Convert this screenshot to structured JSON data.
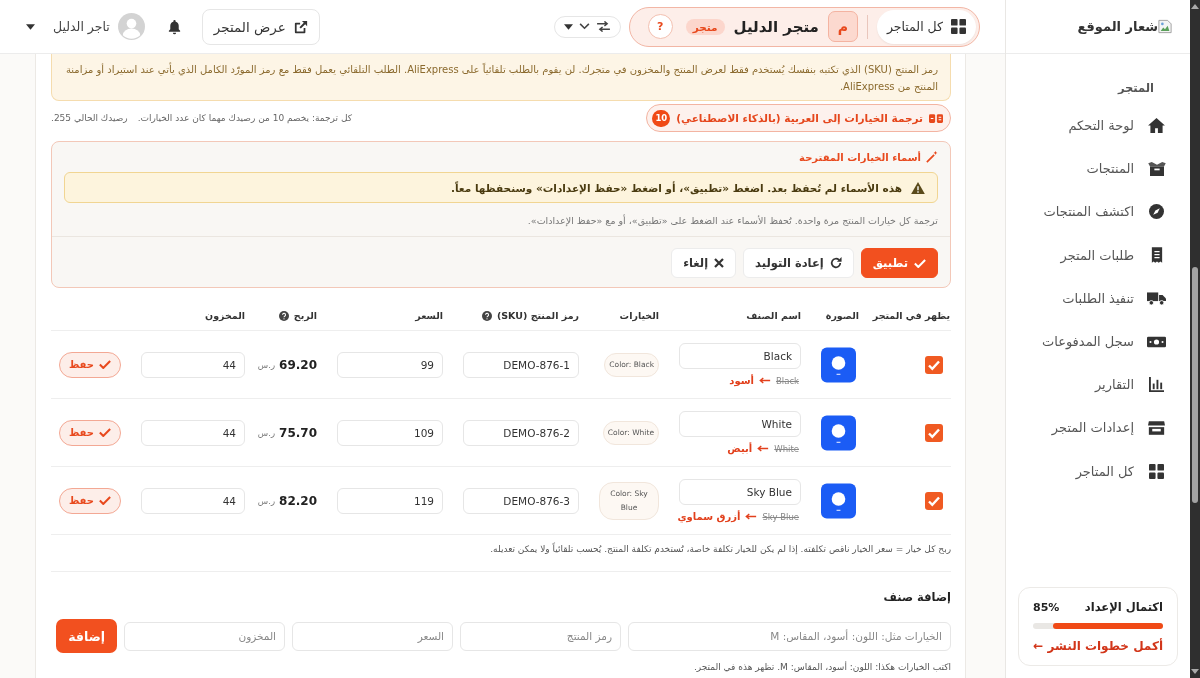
{
  "header": {
    "store_switcher": {
      "all_stores": "كل المتاجر",
      "avatar_letter": "م",
      "store_name": "متجر الدليل",
      "badge": "متجر",
      "help": "?"
    },
    "view_store": "عرض المتجر",
    "user_name": "تاجر الدليل"
  },
  "sidebar": {
    "logo": "شعار الموقع",
    "section": "المتجر",
    "items": [
      {
        "label": "لوحة التحكم",
        "selected": false
      },
      {
        "label": "المنتجات",
        "selected": false
      },
      {
        "label": "اكتشف المنتجات",
        "selected": false
      },
      {
        "label": "طلبات المتجر",
        "selected": false
      },
      {
        "label": "تنفيذ الطلبات",
        "selected": false
      },
      {
        "label": "سجل المدفوعات",
        "selected": false
      },
      {
        "label": "التقارير",
        "selected": false
      },
      {
        "label": "إعدادات المتجر",
        "selected": false
      },
      {
        "label": "كل المتاجر",
        "selected": false
      }
    ],
    "setup": {
      "title": "اكتمال الإعداد",
      "percent": "85%",
      "level": 0.85,
      "link": "أكمل خطوات النشر ←"
    }
  },
  "notice": {
    "text": "رمز المنتج (SKU) الذي تكتبه بنفسك يُستخدم فقط لعرض المنتج والمخزون في متجرك. لن يقوم بالطلب تلقائياً على AliExpress. الطلب التلقائي يعمل فقط مع رمز المورّد الكامل الذي يأتي عند استيراد أو مزامنة المنتج من AliExpress."
  },
  "translate": {
    "button": "ترجمة الخيارات إلى العربية (بالذكاء الاصطناعي)",
    "cost_badge": "10",
    "cost_note": "كل ترجمة: يخصم 10 من رصيدك مهما كان عدد الخيارات.",
    "balance": "رصيدك الحالي 255."
  },
  "suggestions": {
    "title": "أسماء الخيارات المقترحة",
    "warning": "هذه الأسماء لم تُحفظ بعد. اضغط «تطبيق»، أو اضغط «حفظ الإعدادات» وسنحفظها معاً.",
    "description": "ترجمة كل خيارات المنتج مرة واحدة. تُحفظ الأسماء عند الضغط على «تطبيق»، أو مع «حفظ الإعدادات».",
    "buttons": [
      {
        "label": "تطبيق",
        "kind": "primary"
      },
      {
        "label": "إعادة التوليد",
        "kind": "secondary"
      },
      {
        "label": "إلغاء",
        "kind": "secondary"
      }
    ]
  },
  "variants_table": {
    "columns": [
      {
        "label": "يظهر في المتجر",
        "help": false
      },
      {
        "label": "الصورة",
        "help": false
      },
      {
        "label": "اسم الصنف",
        "help": false
      },
      {
        "label": "الخيارات",
        "help": false
      },
      {
        "label": "رمز المنتج (SKU)",
        "help": true
      },
      {
        "label": "السعر",
        "help": false
      },
      {
        "label": "الربح",
        "help": true
      },
      {
        "label": "المخزون",
        "help": false
      }
    ],
    "rows": [
      {
        "checked": true,
        "name": "Black",
        "original": "Black",
        "translation": "أسود",
        "options": "Color: Black",
        "sku": "DEMO-876-1",
        "price": "99",
        "profit": "69.20",
        "currency": "ر.س",
        "stock": "44",
        "save": "حفظ"
      },
      {
        "checked": true,
        "name": "White",
        "original": "White",
        "translation": "أبيض",
        "options": "Color: White",
        "sku": "DEMO-876-2",
        "price": "109",
        "profit": "75.70",
        "currency": "ر.س",
        "stock": "44",
        "save": "حفظ"
      },
      {
        "checked": true,
        "name": "Sky Blue",
        "original": "Sky Blue",
        "translation": "أزرق سماوي",
        "options": "Color: Sky Blue",
        "sku": "DEMO-876-3",
        "price": "119",
        "profit": "82.20",
        "currency": "ر.س",
        "stock": "44",
        "save": "حفظ"
      }
    ],
    "note": "ربح كل خيار = سعر الخيار ناقص تكلفته. إذا لم يكن للخيار تكلفة خاصة، تُستخدم تكلفة المنتج. يُحسب تلقائياً ولا يمكن تعديله."
  },
  "add_variant": {
    "title": "إضافة صنف",
    "fields": [
      {
        "placeholder": "الخيارات مثل: اللون: أسود، المقاس: M"
      },
      {
        "placeholder": "رمز المنتج"
      },
      {
        "placeholder": "السعر"
      },
      {
        "placeholder": "المخزون"
      }
    ],
    "button": "إضافة",
    "hint": "اكتب الخيارات هكذا: اللون: أسود، المقاس: M. تظهر هذه في المتجر."
  }
}
